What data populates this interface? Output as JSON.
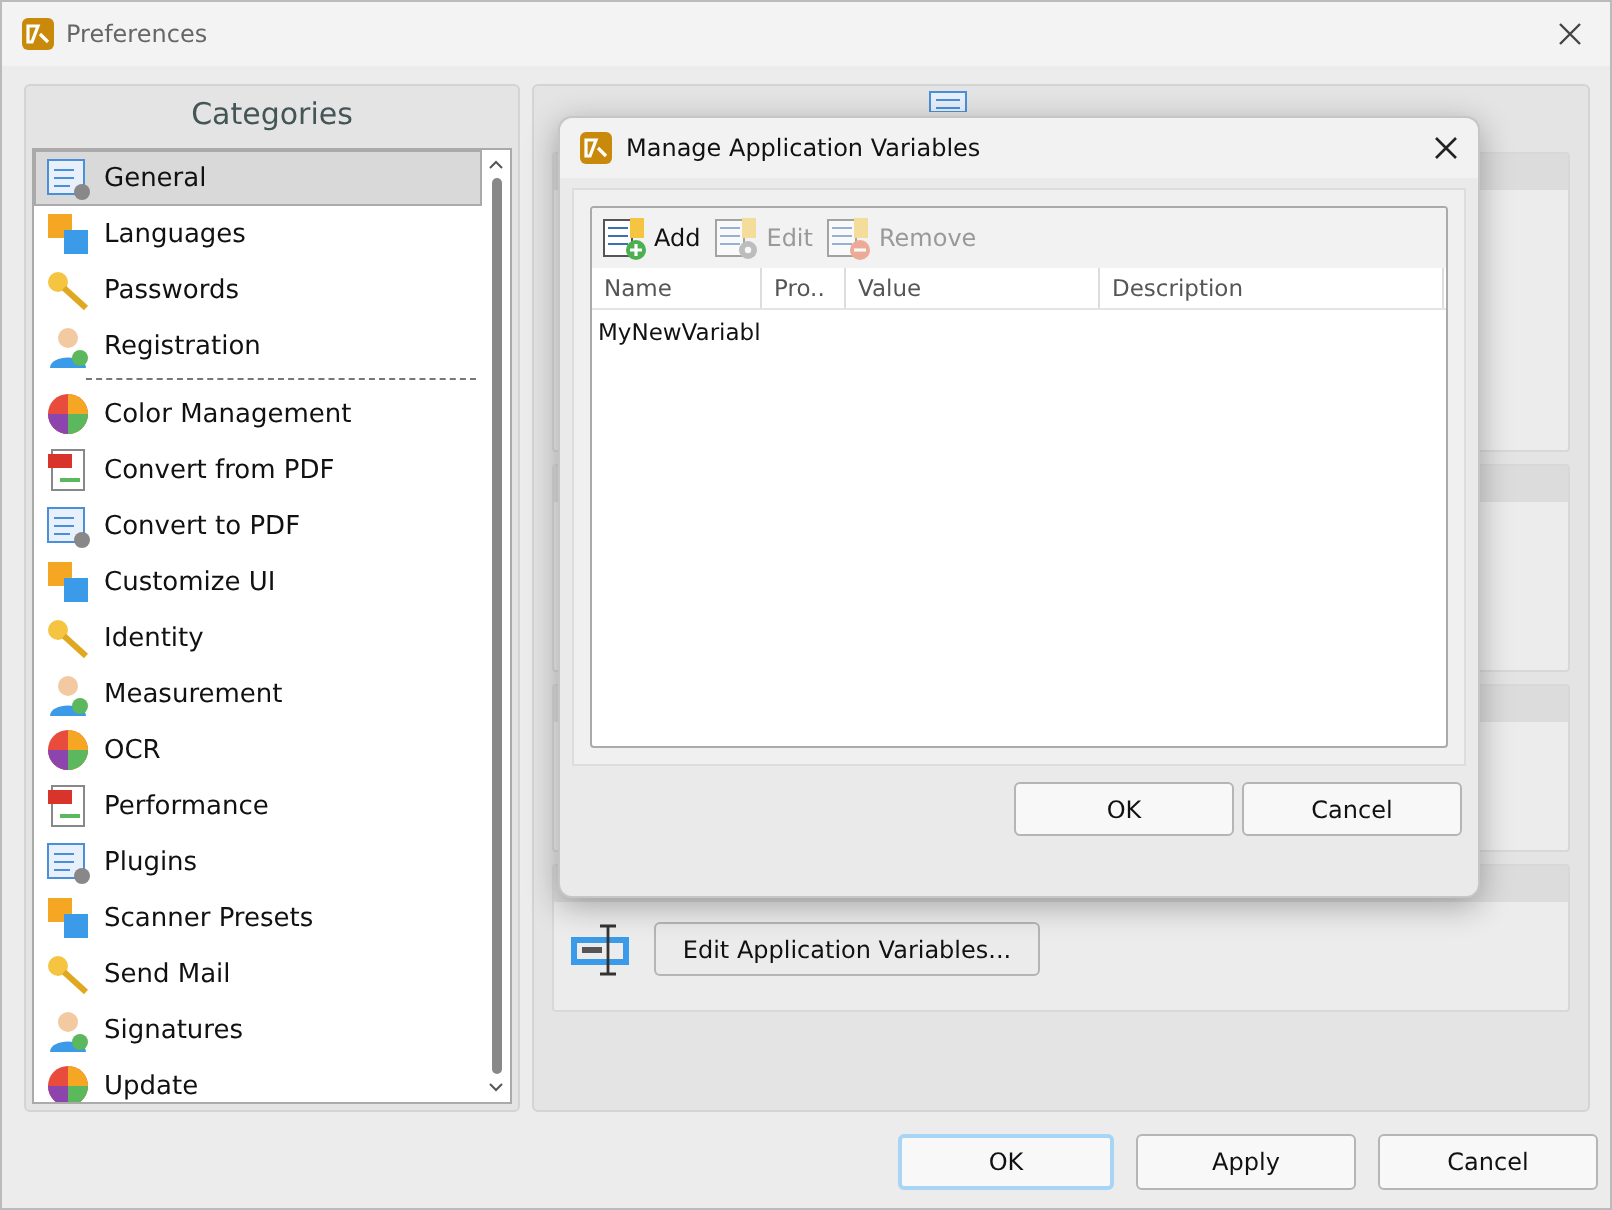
{
  "window": {
    "title": "Preferences"
  },
  "categories": {
    "title": "Categories",
    "items": [
      {
        "label": "General",
        "selected": true,
        "divider_above": false
      },
      {
        "label": "Languages",
        "selected": false,
        "divider_above": false
      },
      {
        "label": "Passwords",
        "selected": false,
        "divider_above": false
      },
      {
        "label": "Registration",
        "selected": false,
        "divider_above": false
      },
      {
        "label": "Color Management",
        "selected": false,
        "divider_above": true
      },
      {
        "label": "Convert from PDF",
        "selected": false,
        "divider_above": false
      },
      {
        "label": "Convert to PDF",
        "selected": false,
        "divider_above": false
      },
      {
        "label": "Customize UI",
        "selected": false,
        "divider_above": false
      },
      {
        "label": "Identity",
        "selected": false,
        "divider_above": false
      },
      {
        "label": "Measurement",
        "selected": false,
        "divider_above": false
      },
      {
        "label": "OCR",
        "selected": false,
        "divider_above": false
      },
      {
        "label": "Performance",
        "selected": false,
        "divider_above": false
      },
      {
        "label": "Plugins",
        "selected": false,
        "divider_above": false
      },
      {
        "label": "Scanner Presets",
        "selected": false,
        "divider_above": false
      },
      {
        "label": "Send Mail",
        "selected": false,
        "divider_above": false
      },
      {
        "label": "Signatures",
        "selected": false,
        "divider_above": false
      },
      {
        "label": "Update",
        "selected": false,
        "divider_above": false
      }
    ]
  },
  "settings": {
    "edit_button": "Edit Application Variables..."
  },
  "dialog": {
    "title": "Manage Application Variables",
    "toolbar": [
      {
        "label": "Add",
        "disabled": false
      },
      {
        "label": "Edit",
        "disabled": true
      },
      {
        "label": "Remove",
        "disabled": true
      }
    ],
    "columns": [
      "Name",
      "Pro..",
      "Value",
      "Description"
    ],
    "rows": [
      [
        "MyNewVariabl"
      ]
    ],
    "buttons": [
      "OK",
      "Cancel"
    ]
  },
  "buttons": [
    {
      "label": "OK",
      "default": true
    },
    {
      "label": "Apply",
      "default": false
    },
    {
      "label": "Cancel",
      "default": false
    }
  ]
}
